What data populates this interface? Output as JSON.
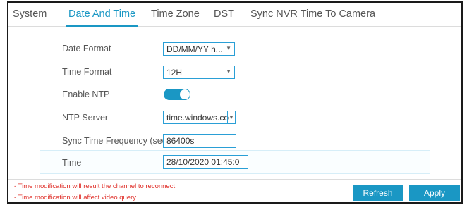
{
  "tabs": [
    {
      "label": "System"
    },
    {
      "label": "Date And Time"
    },
    {
      "label": "Time Zone"
    },
    {
      "label": "DST"
    },
    {
      "label": "Sync NVR Time To Camera"
    }
  ],
  "active_tab": "Date And Time",
  "form": {
    "date_format": {
      "label": "Date Format",
      "value": "DD/MM/YY h..."
    },
    "time_format": {
      "label": "Time Format",
      "value": "12H"
    },
    "enable_ntp": {
      "label": "Enable NTP",
      "enabled": true
    },
    "ntp_server": {
      "label": "NTP Server",
      "value": "time.windows.co"
    },
    "sync_frequency": {
      "label": "Sync Time Frequency (sec)",
      "value": "86400s"
    },
    "time": {
      "label": "Time",
      "value": "28/10/2020 01:45:0"
    }
  },
  "notes": [
    "- Time modification will result the channel to reconnect",
    "- Time modification will affect video query"
  ],
  "buttons": {
    "refresh": "Refresh",
    "apply": "Apply"
  },
  "colors": {
    "accent": "#1a97c4",
    "warning": "#e0302a"
  }
}
